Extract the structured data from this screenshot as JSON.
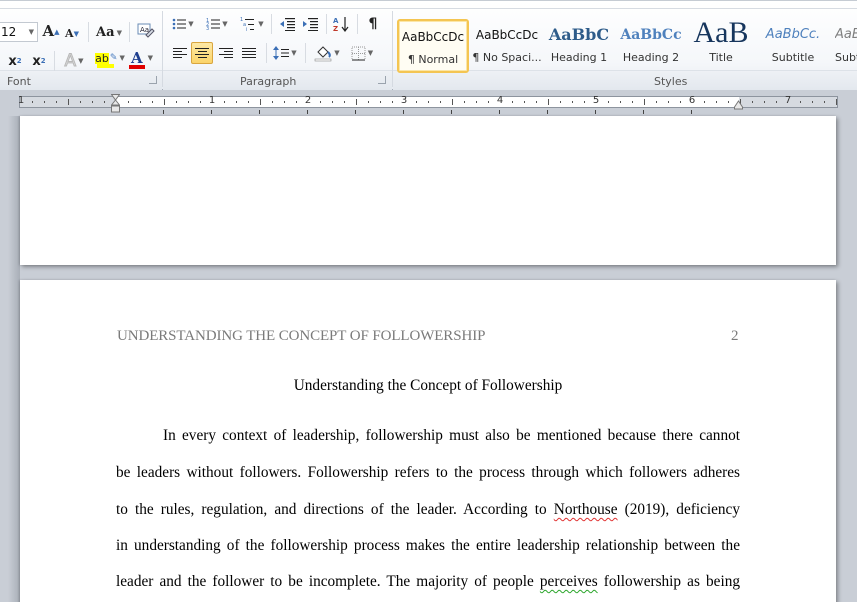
{
  "ribbon": {
    "font_group": {
      "label": "Font",
      "font_size": "12",
      "grow_font": "A",
      "shrink_font": "A",
      "change_case": "Aa",
      "clear_formatting": "clear-formatting",
      "subscript": "x",
      "superscript": "x",
      "text_effects": "A",
      "highlight": "ab",
      "font_color": "A",
      "highlight_color": "#ffff00",
      "font_color_value": "#e00000"
    },
    "paragraph_group": {
      "label": "Paragraph",
      "show_marks": "¶",
      "sort": "A↓",
      "active_alignment": "center"
    },
    "styles_group": {
      "label": "Styles",
      "items": [
        {
          "sample": "AaBbCcDc",
          "name": "¶ Normal",
          "selected": true,
          "color": "#111111"
        },
        {
          "sample": "AaBbCcDc",
          "name": "¶ No Spaci...",
          "selected": false,
          "color": "#111111"
        },
        {
          "sample": "AaBbC",
          "name": "Heading 1",
          "selected": false,
          "color": "#2e5c8a"
        },
        {
          "sample": "AaBbCc",
          "name": "Heading 2",
          "selected": false,
          "color": "#4f81bd"
        },
        {
          "sample": "AaB",
          "name": "Title",
          "selected": false,
          "color": "#17365d"
        },
        {
          "sample": "AaBbCc.",
          "name": "Subtitle",
          "selected": false,
          "color": "#4f81bd"
        },
        {
          "sample": "AaBbCc",
          "name": "Subtle Em...",
          "selected": false,
          "color": "#7f7f7f"
        }
      ]
    }
  },
  "ruler": {
    "numbers": [
      "1",
      "1",
      "2",
      "3",
      "4",
      "5",
      "6",
      "7"
    ]
  },
  "document": {
    "running_head": "UNDERSTANDING THE CONCEPT OF FOLLOWERSHIP",
    "page_number": "2",
    "title": "Understanding the Concept of Followership",
    "lines": [
      {
        "text": "In every context of leadership, followership must also be mentioned because there cannot"
      },
      {
        "text": "be leaders without followers. Followership refers to the process through which followers adheres"
      },
      {
        "pre": "to the rules, regulation, and directions of the leader. According to ",
        "flag": "Northouse",
        "post": " (2019), deficiency"
      },
      {
        "text": "in understanding of the followership process makes the entire leadership relationship between the"
      },
      {
        "pre": "leader and the follower to be incomplete. The majority of people ",
        "flag": "perceives",
        "post": " followership as being"
      }
    ]
  }
}
